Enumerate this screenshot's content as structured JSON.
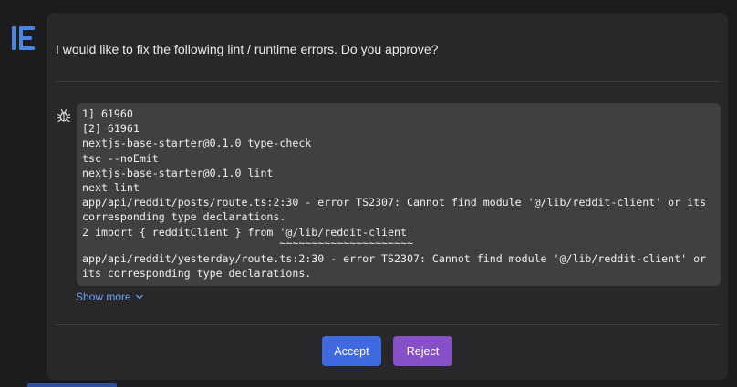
{
  "app": {
    "logo_icon": "editor-logo-icon",
    "accent_color": "#4a86e0"
  },
  "prompt": {
    "question": "I would like to fix the following lint / runtime errors. Do you approve?"
  },
  "errors": {
    "icon": "bug-icon",
    "lines": [
      "1] 61960",
      "[2] 61961",
      "nextjs-base-starter@0.1.0 type-check",
      "tsc --noEmit",
      "nextjs-base-starter@0.1.0 lint",
      "next lint",
      "app/api/reddit/posts/route.ts:2:30 - error TS2307: Cannot find module '@/lib/reddit-client' or its",
      "corresponding type declarations.",
      "2 import { redditClient } from '@/lib/reddit-client'"
    ],
    "squiggle": "                               ~~~~~~~~~~~~~~~~~~~~~",
    "lines_after": [
      "app/api/reddit/yesterday/route.ts:2:30 - error TS2307: Cannot find module '@/lib/reddit-client' or",
      "its corresponding type declarations."
    ],
    "show_more_label": "Show more",
    "show_more_icon": "chevron-down-icon"
  },
  "actions": {
    "accept_label": "Accept",
    "reject_label": "Reject",
    "accept_color": "#3f6ae0",
    "reject_color": "#8850c7"
  }
}
